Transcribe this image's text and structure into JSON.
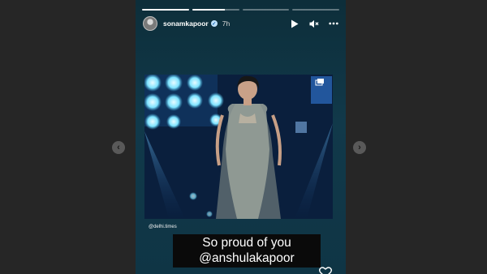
{
  "story": {
    "username": "sonamkapoor",
    "time_ago": "7h",
    "progress": [
      1,
      0.7,
      0,
      0
    ],
    "photo_credit": "@delhi.times",
    "caption_line1": "So proud of you",
    "caption_line2": "@anshulakapoor"
  },
  "icons": {
    "play": "play-icon",
    "mute": "mute-icon",
    "more": "more-icon",
    "prev": "chevron-left-icon",
    "next": "chevron-right-icon",
    "verified": "verified-badge-icon",
    "heart": "heart-icon"
  },
  "colors": {
    "background": "#262626",
    "story_bg": "#11394a",
    "caption_bg": "#0a0a0a",
    "verified": "#bfe2ff"
  }
}
